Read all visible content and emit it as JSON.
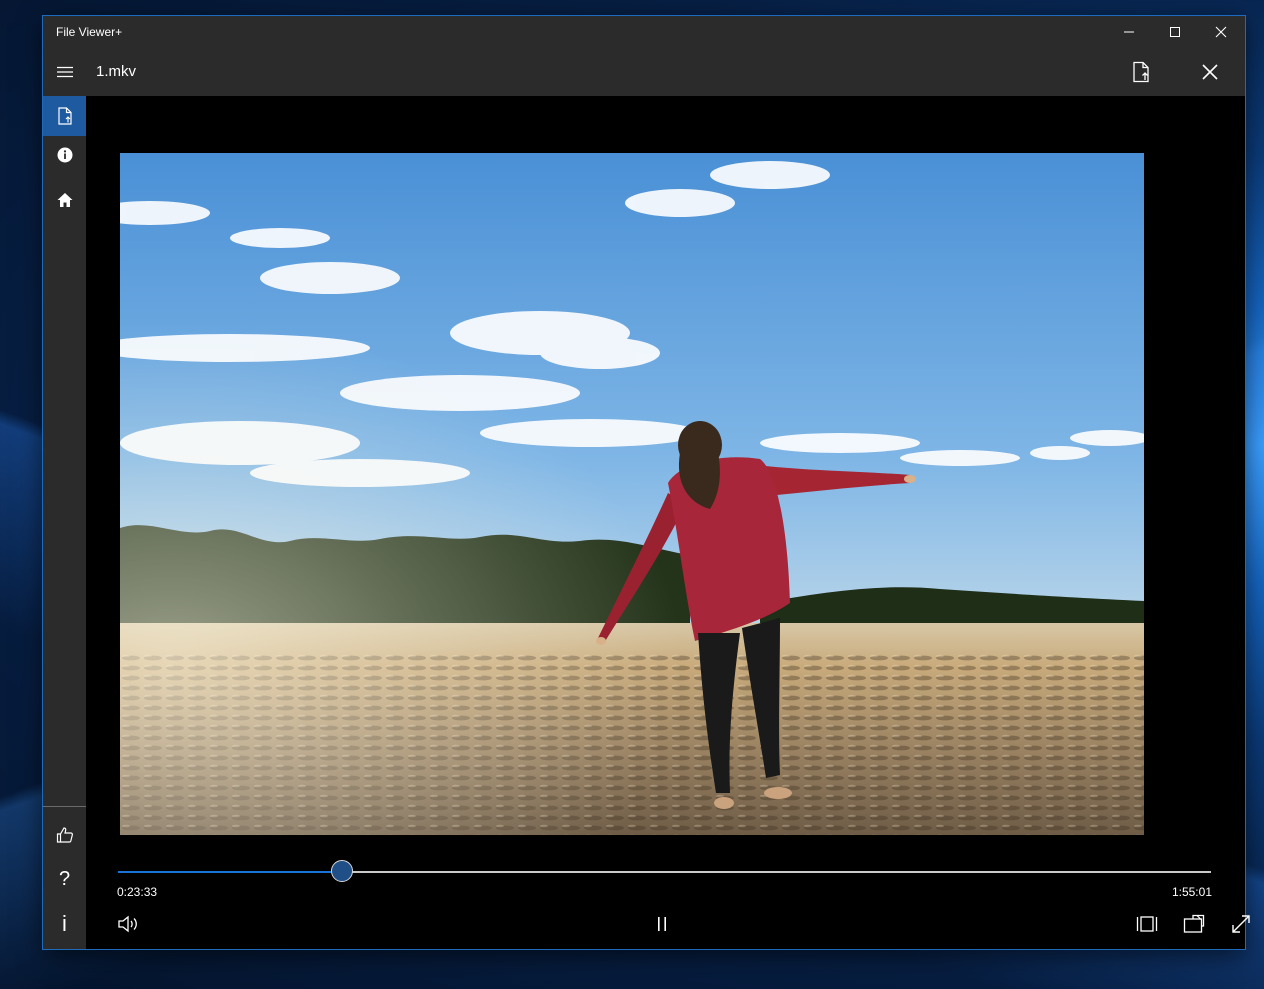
{
  "window": {
    "app_title": "File Viewer+",
    "accent": "#1e5aa0"
  },
  "appbar": {
    "file_name": "1.mkv"
  },
  "sidebar": {
    "items": [
      {
        "icon": "document-icon",
        "active": true
      },
      {
        "icon": "info-icon",
        "active": false
      },
      {
        "icon": "home-icon",
        "active": false
      },
      {
        "icon": "thumbs-up-icon",
        "active": false
      },
      {
        "icon": "help-icon",
        "active": false
      },
      {
        "icon": "about-icon",
        "active": false
      }
    ],
    "help_glyph": "?",
    "about_glyph": "i"
  },
  "player": {
    "current_time": "0:23:33",
    "total_time": "1:55:01",
    "progress": 0.2047
  }
}
